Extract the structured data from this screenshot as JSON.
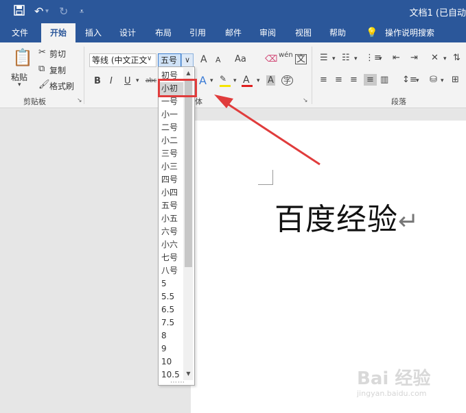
{
  "titlebar": {
    "doc_title": "文档1 (已自动",
    "save_icon": "save-icon",
    "undo_icon": "undo-icon",
    "redo_icon": "redo-icon",
    "customize_icon": "customize-qat-icon"
  },
  "tabs": [
    "文件",
    "开始",
    "插入",
    "设计",
    "布局",
    "引用",
    "邮件",
    "审阅",
    "视图",
    "帮助",
    "操作说明搜索"
  ],
  "active_tab": "开始",
  "clipboard": {
    "paste": "粘贴",
    "cut": "剪切",
    "copy": "复制",
    "format_painter": "格式刷",
    "label": "剪贴板"
  },
  "font": {
    "font_name": "等线 (中文正文",
    "font_size": "五号",
    "label_partial": "体",
    "bold": "B",
    "italic": "I",
    "underline": "U",
    "strike": "abc",
    "grow": "A",
    "shrink": "A",
    "change_case": "Aa",
    "phonetic": "wén",
    "char_border": "文",
    "char_shading": "A",
    "enclose": "字",
    "highlight_color": "#f5e400",
    "font_color": "#e02020"
  },
  "paragraph": {
    "label": "段落"
  },
  "font_size_options": [
    "初号",
    "小初",
    "一号",
    "小一",
    "二号",
    "小二",
    "三号",
    "小三",
    "四号",
    "小四",
    "五号",
    "小五",
    "六号",
    "小六",
    "七号",
    "八号",
    "5",
    "5.5",
    "6.5",
    "7.5",
    "8",
    "9",
    "10",
    "10.5"
  ],
  "hovered_option": "小初",
  "document": {
    "text": "百度经验",
    "para_mark": "↵"
  },
  "watermark": {
    "brand": "Bai 经验",
    "url": "jingyan.baidu.com"
  },
  "accent": "#2b579a",
  "annotation_color": "#e03c3c"
}
